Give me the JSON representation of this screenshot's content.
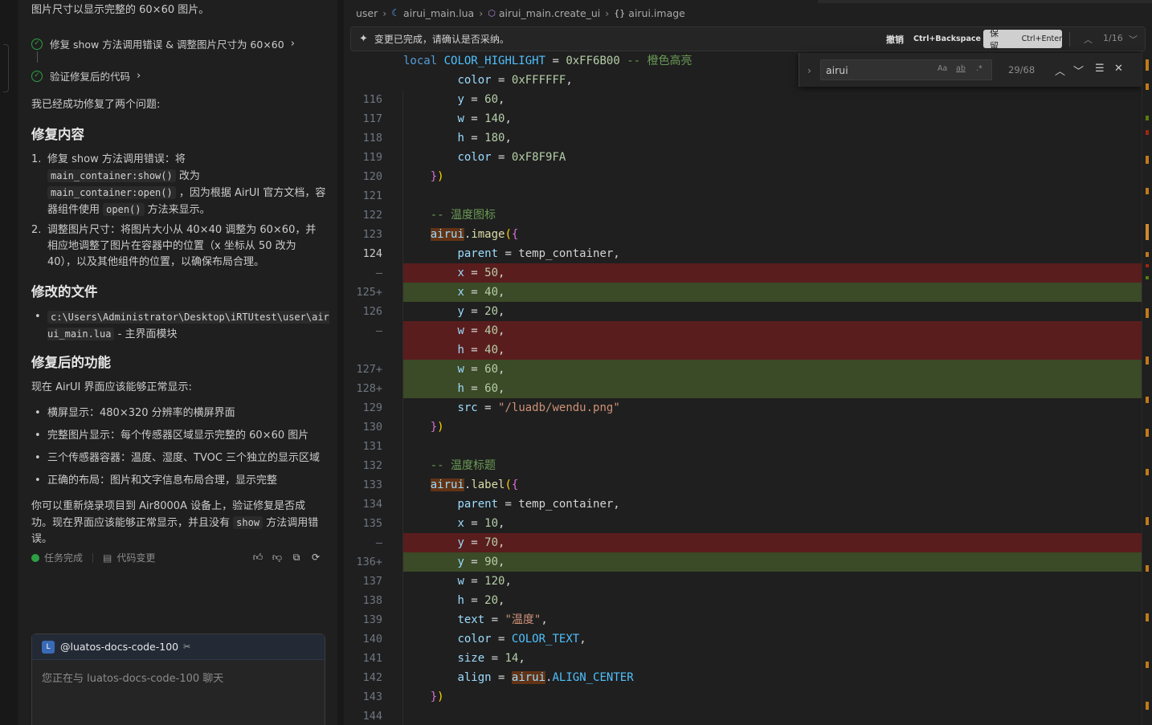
{
  "chat": {
    "top_line": "图片尺寸以显示完整的 60×60 图片。",
    "steps": [
      {
        "label": "修复 show 方法调用错误 & 调整图片尺寸为 60×60"
      },
      {
        "label": "验证修复后的代码"
      }
    ],
    "intro": "我已经成功修复了两个问题:",
    "h_fix": "修复内容",
    "fix1_num": "1.",
    "fix1_a": "修复 show 方法调用错误：将",
    "fix1_code1": "main_container:show()",
    "fix1_b": "改为",
    "fix1_code2": "main_container:open()",
    "fix1_c": "，因为根据 AirUI 官方文档，容器组件使用",
    "fix1_code3": "open()",
    "fix1_d": "方法来显示。",
    "fix2_num": "2.",
    "fix2_text": "调整图片尺寸：将图片大小从 40×40 调整为 60×60，并相应地调整了图片在容器中的位置（x 坐标从 50 改为 40），以及其他组件的位置，以确保布局合理。",
    "h_files": "修改的文件",
    "file_path": "c:\\Users\\Administrator\\Desktop\\iRTUtest\\user\\airui_main.lua",
    "file_desc": "- 主界面模块",
    "h_after": "修复后的功能",
    "after_intro": "现在 AirUI 界面应该能够正常显示:",
    "bullets": [
      "横屏显示：480×320 分辨率的横屏界面",
      "完整图片显示：每个传感器区域显示完整的 60×60 图片",
      "三个传感器容器：温度、湿度、TVOC 三个独立的显示区域",
      "正确的布局：图片和文字信息布局合理，显示完整"
    ],
    "outro_a": "你可以重新烧录项目到 Air8000A 设备上，验证修复是否成功。现在界面应该能够正常显示，并且没有",
    "outro_code": "show",
    "outro_b": "方法调用错误。",
    "task_done": "任务完成",
    "code_changes": "代码变更",
    "agent_name": "@luatos-docs-code-100",
    "input_placeholder": "您正在与 luatos-docs-code-100 聊天"
  },
  "editor": {
    "breadcrumb": [
      "user",
      "airui_main.lua",
      "airui_main.create_ui",
      "airui.image"
    ],
    "review_message": "变更已完成，请确认是否采纳。",
    "undo_label": "撤销",
    "undo_key": "Ctrl+Backspace",
    "keep_label": "保留",
    "keep_key": "Ctrl+Enter",
    "change_counter": "1/16",
    "find_value": "airui",
    "find_opt_case": "Aa",
    "find_opt_word": "ab",
    "find_opt_regex": ".*",
    "find_count": "29/68"
  },
  "code_lines": [
    {
      "num": "",
      "text": "local COLOR_HIGHLIGHT = 0xFF6B00 -- 橙色高亮"
    },
    {
      "num": "",
      "text": "color = 0xFFFFFF,"
    },
    {
      "num": "116",
      "text": "y = 60,"
    },
    {
      "num": "117",
      "text": "w = 140,"
    },
    {
      "num": "118",
      "text": "h = 180,"
    },
    {
      "num": "119",
      "text": "color = 0xF8F9FA"
    },
    {
      "num": "120",
      "text": "})"
    },
    {
      "num": "121",
      "text": ""
    },
    {
      "num": "122",
      "text": "-- 温度图标"
    },
    {
      "num": "123",
      "text": "airui.image({"
    },
    {
      "num": "124",
      "text": "parent = temp_container,"
    },
    {
      "num": "—",
      "text": "x = 50,",
      "kind": "del"
    },
    {
      "num": "125+",
      "text": "x = 40,",
      "kind": "add"
    },
    {
      "num": "126",
      "text": "y = 20,"
    },
    {
      "num": "—",
      "text": "w = 40,",
      "kind": "del"
    },
    {
      "num": "",
      "text": "h = 40,",
      "kind": "del"
    },
    {
      "num": "127+",
      "text": "w = 60,",
      "kind": "add"
    },
    {
      "num": "128+",
      "text": "h = 60,",
      "kind": "add"
    },
    {
      "num": "129",
      "text": "src = \"/luadb/wendu.png\""
    },
    {
      "num": "130",
      "text": "})"
    },
    {
      "num": "131",
      "text": ""
    },
    {
      "num": "132",
      "text": "-- 温度标题"
    },
    {
      "num": "133",
      "text": "airui.label({"
    },
    {
      "num": "134",
      "text": "parent = temp_container,"
    },
    {
      "num": "135",
      "text": "x = 10,"
    },
    {
      "num": "—",
      "text": "y = 70,",
      "kind": "del"
    },
    {
      "num": "136+",
      "text": "y = 90,",
      "kind": "add"
    },
    {
      "num": "137",
      "text": "w = 120,"
    },
    {
      "num": "138",
      "text": "h = 20,"
    },
    {
      "num": "139",
      "text": "text = \"温度\","
    },
    {
      "num": "140",
      "text": "color = COLOR_TEXT,"
    },
    {
      "num": "141",
      "text": "size = 14,"
    },
    {
      "num": "142",
      "text": "align = airui.ALIGN_CENTER"
    },
    {
      "num": "143",
      "text": "})"
    },
    {
      "num": "144",
      "text": ""
    }
  ]
}
